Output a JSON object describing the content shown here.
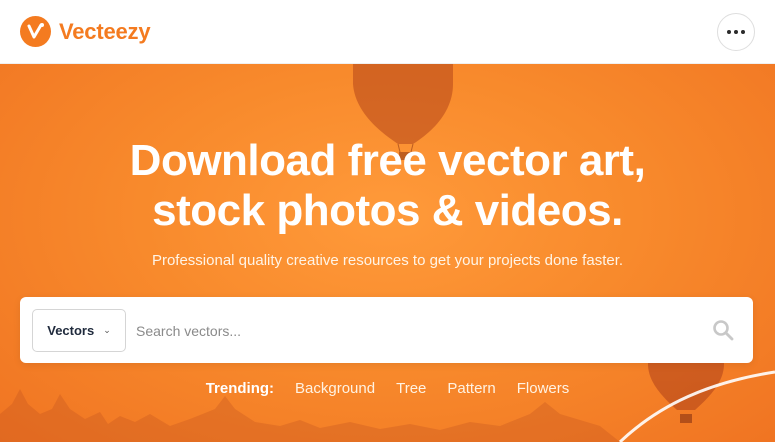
{
  "header": {
    "brand": "Vecteezy",
    "brand_color": "#f47b20"
  },
  "hero": {
    "headline_line1": "Download free vector art,",
    "headline_line2": "stock photos & videos.",
    "subheadline": "Professional quality creative resources to get your projects done faster.",
    "background_color": "#f88a2c"
  },
  "search": {
    "type_selected": "Vectors",
    "placeholder": "Search vectors...",
    "value": ""
  },
  "trending": {
    "label": "Trending:",
    "items": [
      "Background",
      "Tree",
      "Pattern",
      "Flowers"
    ]
  },
  "icons": {
    "logo": "vecteezy-v-logo-icon",
    "menu": "ellipsis-icon",
    "dropdown": "chevron-down-icon",
    "search": "magnifier-icon"
  }
}
